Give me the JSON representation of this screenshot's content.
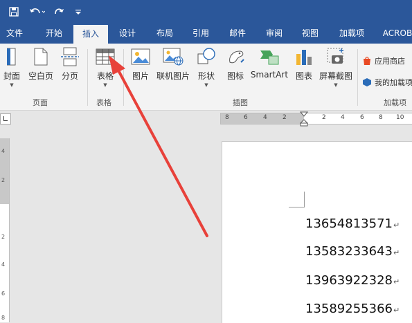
{
  "tabs": [
    "文件",
    "开始",
    "插入",
    "设计",
    "布局",
    "引用",
    "邮件",
    "审阅",
    "视图",
    "加载项",
    "ACROB"
  ],
  "ribbon": {
    "page_group": {
      "label": "页面",
      "items": [
        "封面",
        "空白页",
        "分页"
      ]
    },
    "table_group": {
      "label": "表格",
      "items": [
        "表格"
      ]
    },
    "illustrations_group": {
      "label": "插图",
      "items": [
        "图片",
        "联机图片",
        "形状",
        "图标",
        "SmartArt",
        "图表",
        "屏幕截图"
      ]
    },
    "addins_group": {
      "label": "加载项",
      "items": [
        "应用商店",
        "我的加载项"
      ]
    }
  },
  "ruler": {
    "numbers": [
      "8",
      "6",
      "4",
      "2",
      "2",
      "4",
      "6",
      "8",
      "10"
    ]
  },
  "vruler": {
    "numbers": [
      "4",
      "2",
      "2",
      "4",
      "6",
      "8"
    ]
  },
  "document": {
    "lines": [
      "13654813571",
      "13583233643",
      "13963922328",
      "13589255366"
    ]
  },
  "colors": {
    "titlebar": "#2b579a",
    "annotation_arrow": "#e8413a"
  }
}
